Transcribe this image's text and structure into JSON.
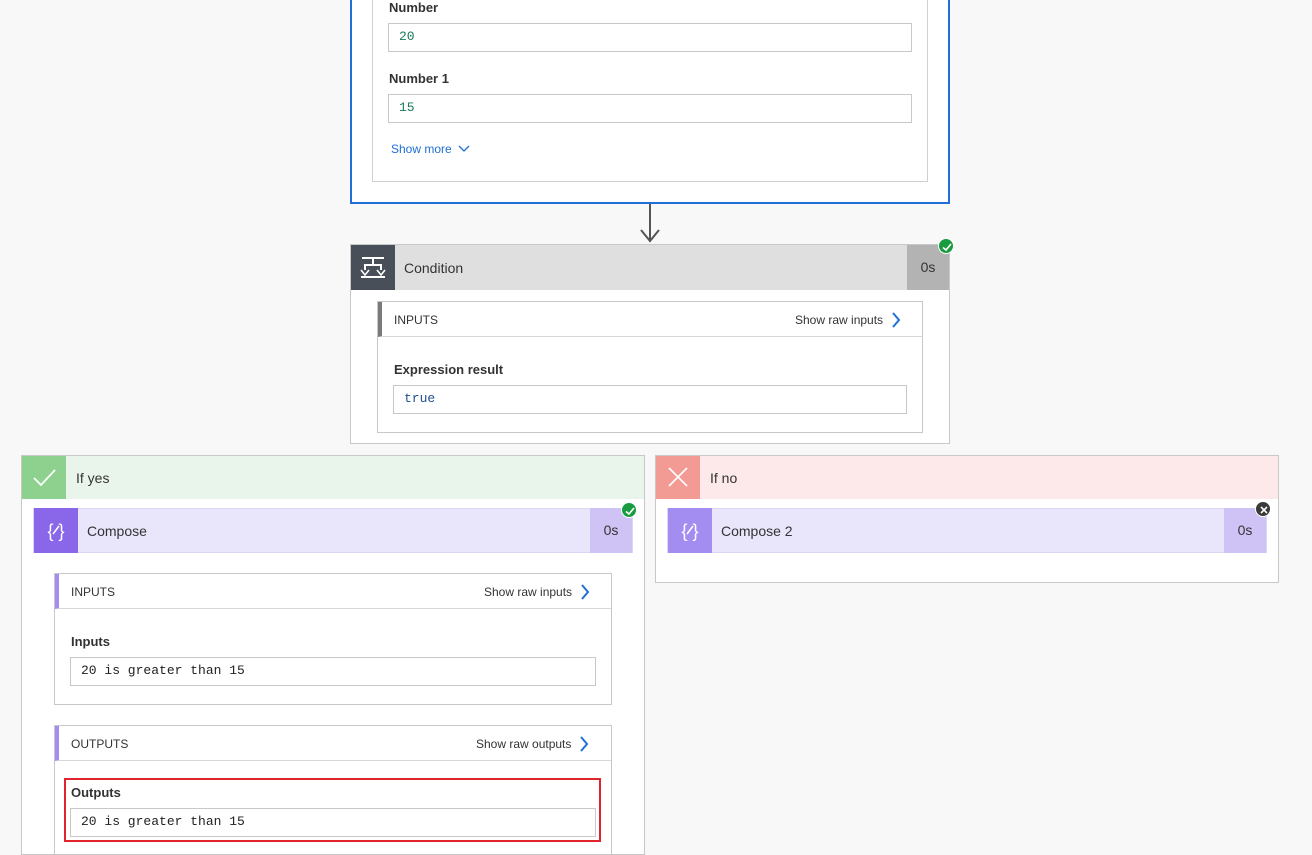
{
  "trigger": {
    "fields": [
      {
        "label": "Number",
        "value": "20"
      },
      {
        "label": "Number 1",
        "value": "15"
      }
    ],
    "show_more": "Show more"
  },
  "condition": {
    "title": "Condition",
    "duration": "0s",
    "inputs_label": "INPUTS",
    "show_raw_inputs": "Show raw inputs",
    "expression_label": "Expression result",
    "expression_value": "true"
  },
  "if_yes": {
    "title": "If yes",
    "compose": {
      "title": "Compose",
      "duration": "0s",
      "inputs_label": "INPUTS",
      "show_raw_inputs": "Show raw inputs",
      "inputs_field_label": "Inputs",
      "inputs_value": "20 is greater than 15",
      "outputs_label": "OUTPUTS",
      "show_raw_outputs": "Show raw outputs",
      "outputs_field_label": "Outputs",
      "outputs_value": "20 is greater than 15"
    }
  },
  "if_no": {
    "title": "If no",
    "compose": {
      "title": "Compose 2",
      "duration": "0s"
    }
  },
  "colors": {
    "accent_blue": "#1f6fd6",
    "success_green": "#199b3f",
    "compose_purple": "#8a66e8",
    "highlight_red": "#e0242d"
  }
}
